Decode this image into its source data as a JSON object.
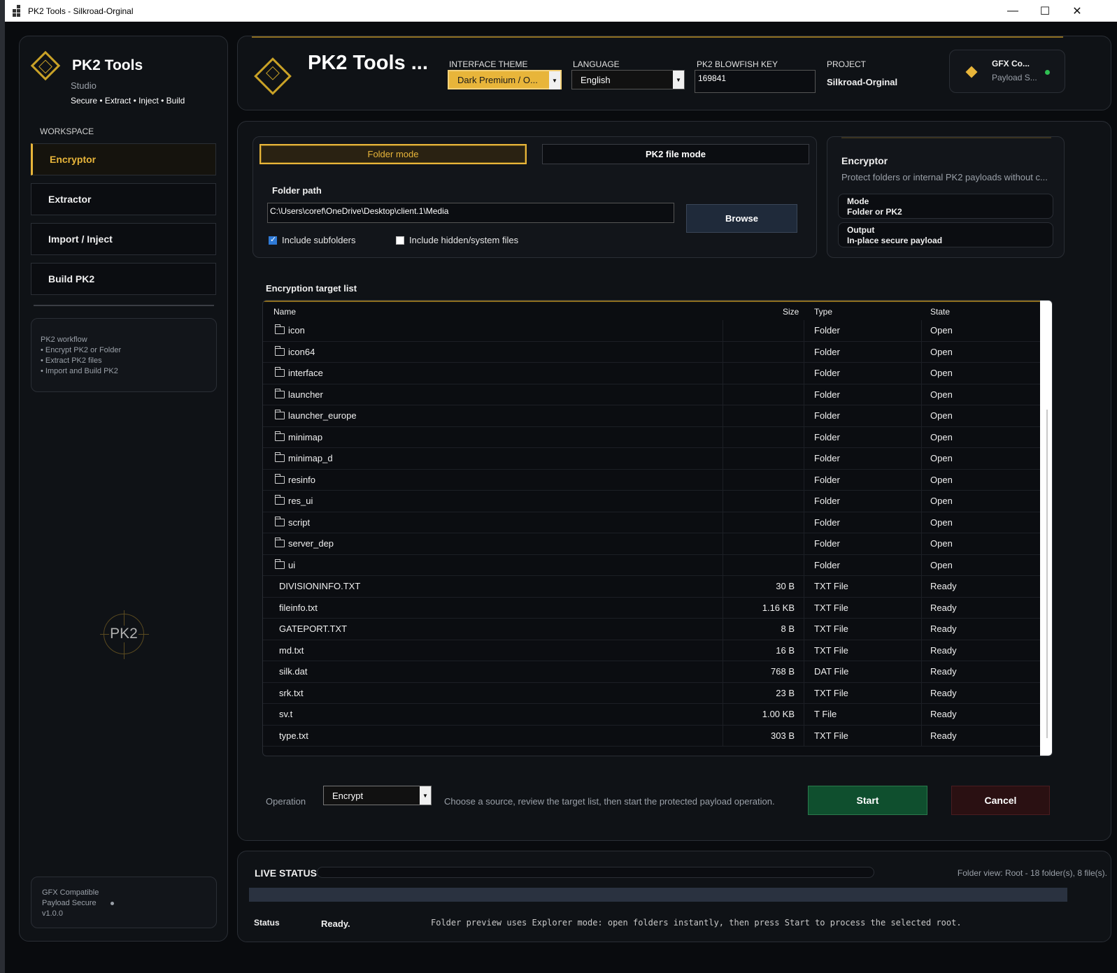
{
  "window": {
    "title": "PK2 Tools - Silkroad-Orginal",
    "controls": {
      "minimize": "—",
      "maximize": "☐",
      "close": "✕"
    }
  },
  "sidebar": {
    "app_name": "PK2 Tools",
    "subtitle": "Studio",
    "tagline": "Secure • Extract • Inject • Build",
    "workspace_label": "WORKSPACE",
    "items": [
      {
        "label": "Encryptor",
        "active": true
      },
      {
        "label": "Extractor",
        "active": false
      },
      {
        "label": "Import / Inject",
        "active": false
      },
      {
        "label": "Build PK2",
        "active": false
      }
    ],
    "workflow": {
      "title": "PK2 workflow",
      "lines": [
        "• Encrypt PK2 or Folder",
        "• Extract PK2 files",
        "• Import and Build PK2"
      ]
    },
    "emblem_text": "PK2",
    "footer": {
      "line1": "GFX Compatible",
      "line2": "Payload Secure",
      "line3": "v1.0.0"
    }
  },
  "header": {
    "title": "PK2 Tools ...",
    "theme_label": "INTERFACE THEME",
    "theme_value": "Dark Premium / O...",
    "language_label": "LANGUAGE",
    "language_value": "English",
    "key_label": "PK2 BLOWFISH KEY",
    "key_value": "169841",
    "project_label": "PROJECT",
    "project_value": "Silkroad-Orginal",
    "gfx_title": "GFX Co...",
    "gfx_sub": "Payload S...",
    "accent": "#e8b53a"
  },
  "source": {
    "folder_mode": "Folder mode",
    "pk2_mode": "PK2 file mode",
    "folder_path_label": "Folder path",
    "folder_path": "C:\\Users\\coref\\OneDrive\\Desktop\\client.1\\Media",
    "browse": "Browse",
    "include_subfolders": "Include subfolders",
    "include_subfolders_checked": true,
    "include_hidden": "Include hidden/system files",
    "include_hidden_checked": false
  },
  "info": {
    "title": "Encryptor",
    "desc": "Protect folders or internal PK2 payloads without c...",
    "mode_label": "Mode",
    "mode_value": "Folder or PK2",
    "output_label": "Output",
    "output_value": "In-place secure payload"
  },
  "targets": {
    "title": "Encryption target list",
    "columns": {
      "name": "Name",
      "size": "Size",
      "type": "Type",
      "state": "State"
    },
    "rows": [
      {
        "name": "icon",
        "size": "",
        "type": "Folder",
        "state": "Open",
        "folder": true
      },
      {
        "name": "icon64",
        "size": "",
        "type": "Folder",
        "state": "Open",
        "folder": true
      },
      {
        "name": "interface",
        "size": "",
        "type": "Folder",
        "state": "Open",
        "folder": true
      },
      {
        "name": "launcher",
        "size": "",
        "type": "Folder",
        "state": "Open",
        "folder": true
      },
      {
        "name": "launcher_europe",
        "size": "",
        "type": "Folder",
        "state": "Open",
        "folder": true
      },
      {
        "name": "minimap",
        "size": "",
        "type": "Folder",
        "state": "Open",
        "folder": true
      },
      {
        "name": "minimap_d",
        "size": "",
        "type": "Folder",
        "state": "Open",
        "folder": true
      },
      {
        "name": "resinfo",
        "size": "",
        "type": "Folder",
        "state": "Open",
        "folder": true
      },
      {
        "name": "res_ui",
        "size": "",
        "type": "Folder",
        "state": "Open",
        "folder": true
      },
      {
        "name": "script",
        "size": "",
        "type": "Folder",
        "state": "Open",
        "folder": true
      },
      {
        "name": "server_dep",
        "size": "",
        "type": "Folder",
        "state": "Open",
        "folder": true
      },
      {
        "name": "ui",
        "size": "",
        "type": "Folder",
        "state": "Open",
        "folder": true
      },
      {
        "name": "DIVISIONINFO.TXT",
        "size": "30 B",
        "type": "TXT File",
        "state": "Ready",
        "folder": false
      },
      {
        "name": "fileinfo.txt",
        "size": "1.16 KB",
        "type": "TXT File",
        "state": "Ready",
        "folder": false
      },
      {
        "name": "GATEPORT.TXT",
        "size": "8 B",
        "type": "TXT File",
        "state": "Ready",
        "folder": false
      },
      {
        "name": "md.txt",
        "size": "16 B",
        "type": "TXT File",
        "state": "Ready",
        "folder": false
      },
      {
        "name": "silk.dat",
        "size": "768 B",
        "type": "DAT File",
        "state": "Ready",
        "folder": false
      },
      {
        "name": "srk.txt",
        "size": "23 B",
        "type": "TXT File",
        "state": "Ready",
        "folder": false
      },
      {
        "name": "sv.t",
        "size": "1.00 KB",
        "type": "T File",
        "state": "Ready",
        "folder": false
      },
      {
        "name": "type.txt",
        "size": "303 B",
        "type": "TXT File",
        "state": "Ready",
        "folder": false
      }
    ]
  },
  "operation": {
    "label": "Operation",
    "value": "Encrypt",
    "hint": "Choose a source, review the target list, then start the protected payload operation.",
    "start": "Start",
    "cancel": "Cancel"
  },
  "status": {
    "title": "LIVE STATUS",
    "view": "Folder view: Root - 18 folder(s), 8 file(s).",
    "status_label": "Status",
    "status_value": "Ready.",
    "message": "Folder preview uses Explorer mode: open folders instantly, then press Start to process the selected root.",
    "progress": 0
  }
}
